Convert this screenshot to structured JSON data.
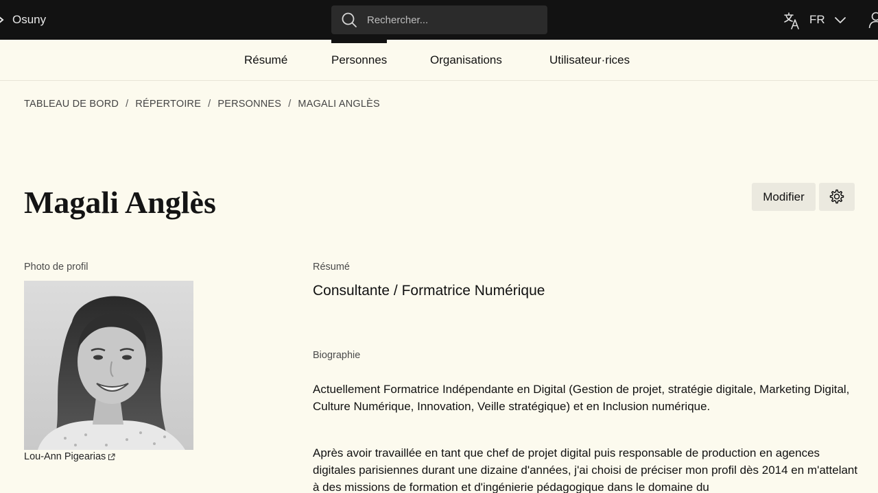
{
  "topbar": {
    "brand": "Osuny",
    "search_placeholder": "Rechercher...",
    "language": "FR",
    "icons": [
      "logo-icon",
      "search-icon",
      "translate-icon",
      "chevron-down-icon",
      "user-icon"
    ]
  },
  "subnav": {
    "tabs": [
      {
        "label": "Résumé",
        "active": false
      },
      {
        "label": "Personnes",
        "active": true
      },
      {
        "label": "Organisations",
        "active": false
      },
      {
        "label": "Utilisateur·rices",
        "active": false
      }
    ]
  },
  "breadcrumb": [
    "TABLEAU DE BORD",
    "RÉPERTOIRE",
    "PERSONNES",
    "MAGALI ANGLÈS"
  ],
  "breadcrumb_separator": "/",
  "page": {
    "title": "Magali Anglès",
    "edit_label": "Modifier"
  },
  "profile": {
    "photo_label": "Photo de profil",
    "photo_credit": "Lou-Ann Pigearias",
    "summary_label": "Résumé",
    "summary": "Consultante / Formatrice Numérique",
    "bio_label": "Biographie",
    "bio_paragraph_1": "Actuellement Formatrice Indépendante en Digital (Gestion de projet, stratégie digitale, Marketing Digital, Culture Numérique, Innovation, Veille stratégique) et en Inclusion numérique.",
    "bio_paragraph_2": "Après avoir travaillée en tant que chef de projet digital puis responsable de production en agences digitales parisiennes durant une dizaine d'années, j'ai choisi de préciser mon profil dès 2014 en m'attelant à des missions de formation et d'ingénierie pédagogique dans le domaine du"
  },
  "colors": {
    "topbar_bg": "#121212",
    "page_bg": "#fcfaee",
    "button_bg": "#ebe9df"
  }
}
